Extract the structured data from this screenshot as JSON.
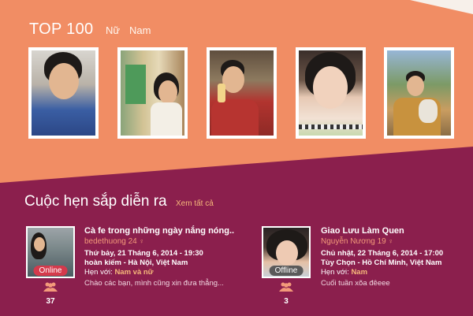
{
  "top": {
    "title": "TOP 100",
    "tabs": [
      "Nữ",
      "Nam"
    ]
  },
  "upcoming": {
    "heading": "Cuộc hẹn sắp diễn ra",
    "see_all": "Xem tất cả",
    "cards": [
      {
        "title": "Cà fe trong những ngày nắng nóng..",
        "host": "bedethuong 24",
        "date": "Thứ bảy, 21 Tháng 6, 2014 - 19:30",
        "location": "hoàn kiếm - Hà Nội, Việt Nam",
        "meet_label": "Hẹn với: ",
        "meet_value": "Nam và nữ",
        "description": "Chào các bạn, mình cũng xin đưa thẳng...",
        "status": "Online",
        "count": "37"
      },
      {
        "title": "Giao Lưu Làm Quen",
        "host": "Nguyễn Nương 19",
        "date": "Chủ nhật, 22 Tháng 6, 2014 - 17:00",
        "location": "Tùy Chọn - Hồ Chí Minh, Việt Nam",
        "meet_label": "Hẹn với: ",
        "meet_value": "Nam",
        "description": "Cuối tuần xõa đêeee",
        "status": "Offline",
        "count": "3"
      }
    ]
  },
  "colors": {
    "top_background": "#f18d64",
    "bottom_background": "#8b1f4d",
    "accent": "#f39a7a",
    "online_badge": "#d43a4c"
  },
  "icons": {
    "gender_pin": "female-symbol-icon",
    "attendees": "people-icon"
  }
}
